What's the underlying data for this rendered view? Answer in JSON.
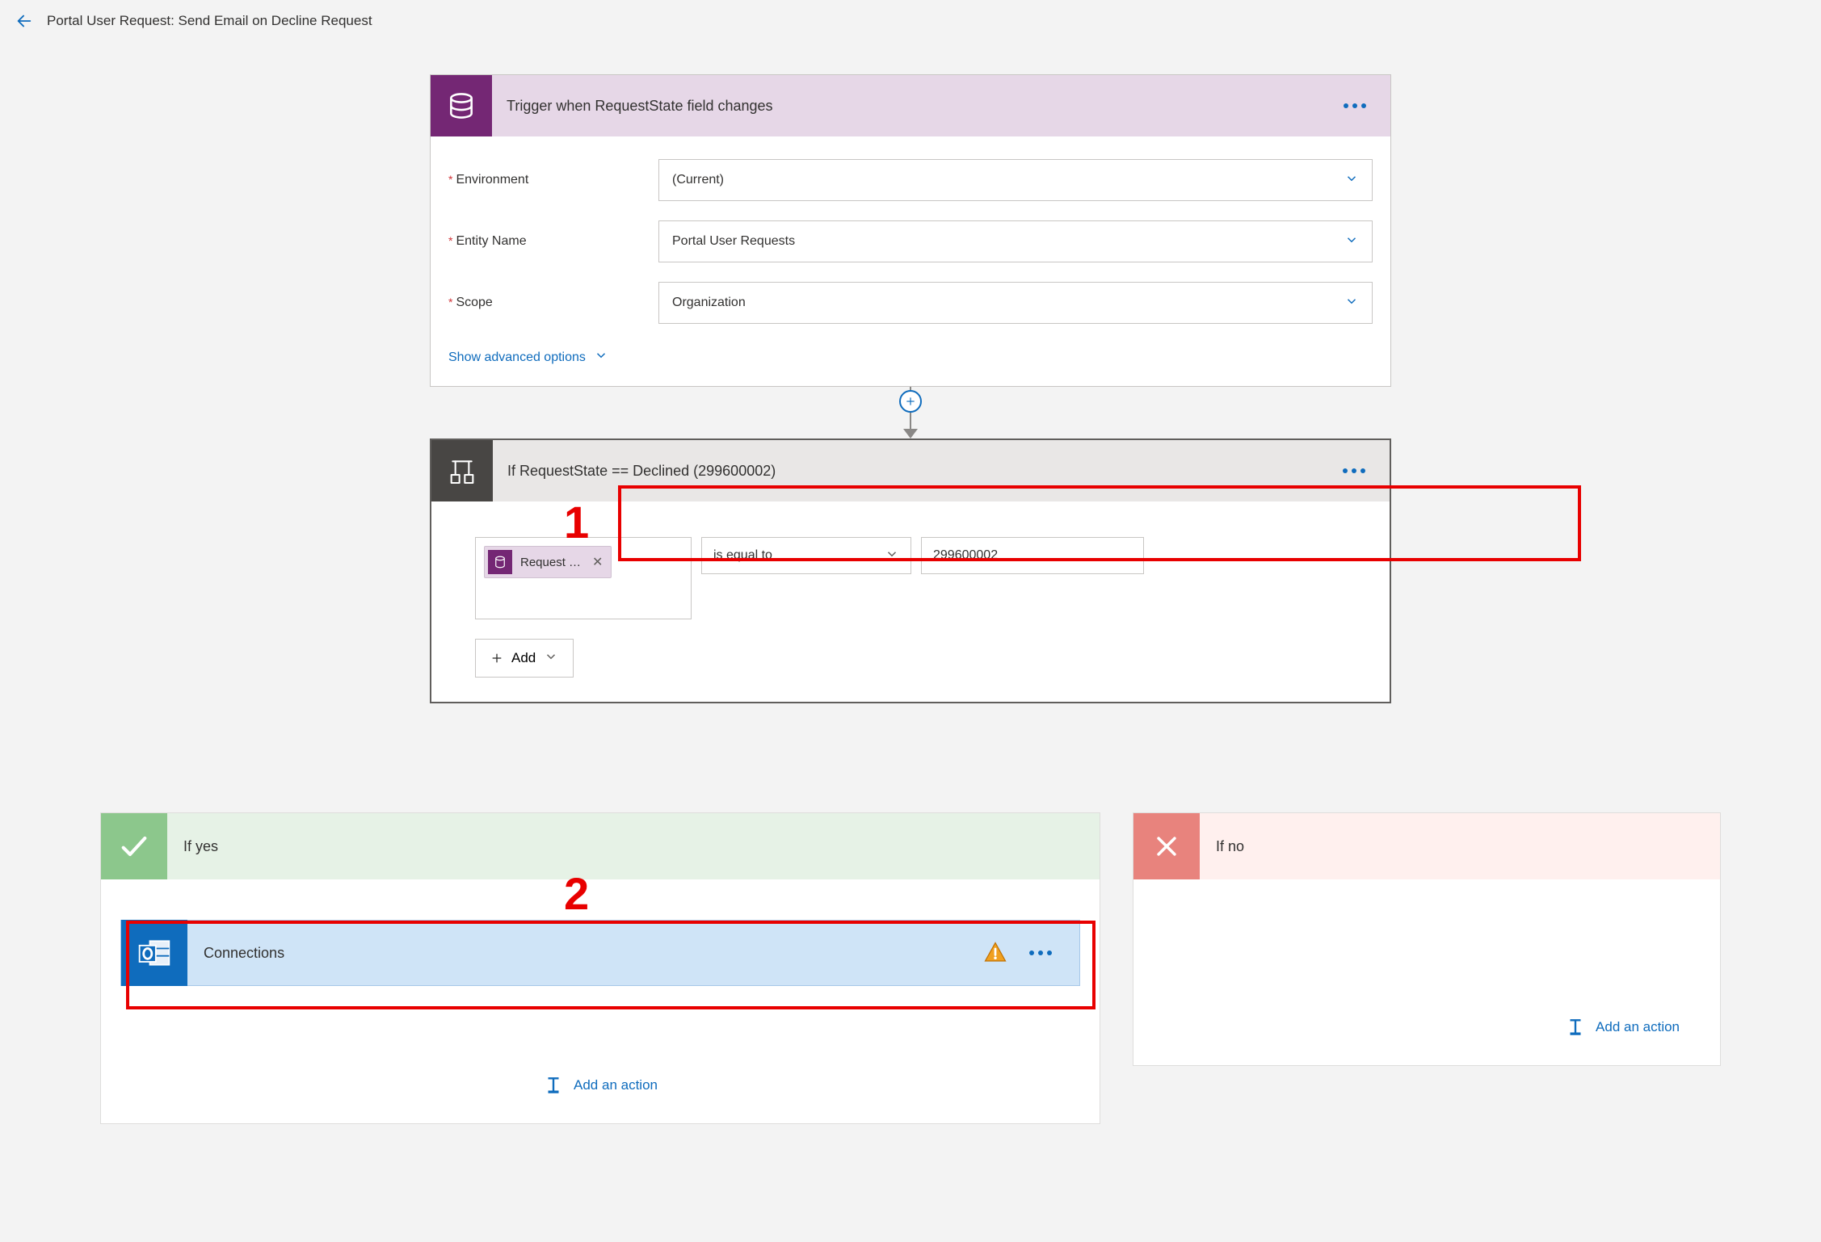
{
  "header": {
    "title": "Portal User Request: Send Email on Decline Request"
  },
  "trigger": {
    "title": "Trigger when RequestState field changes",
    "fields": {
      "environment": {
        "label": "Environment",
        "value": "(Current)"
      },
      "entity": {
        "label": "Entity Name",
        "value": "Portal User Requests"
      },
      "scope": {
        "label": "Scope",
        "value": "Organization"
      }
    },
    "advanced": "Show advanced options"
  },
  "condition": {
    "title": "If RequestState == Declined (299600002)",
    "token": "Request …",
    "operator": "is equal to",
    "value": "299600002",
    "add": "Add"
  },
  "branches": {
    "yes": {
      "title": "If yes",
      "action": {
        "title": "Connections"
      },
      "addAction": "Add an action"
    },
    "no": {
      "title": "If no",
      "addAction": "Add an action"
    }
  },
  "callouts": {
    "one": "1",
    "two": "2"
  }
}
